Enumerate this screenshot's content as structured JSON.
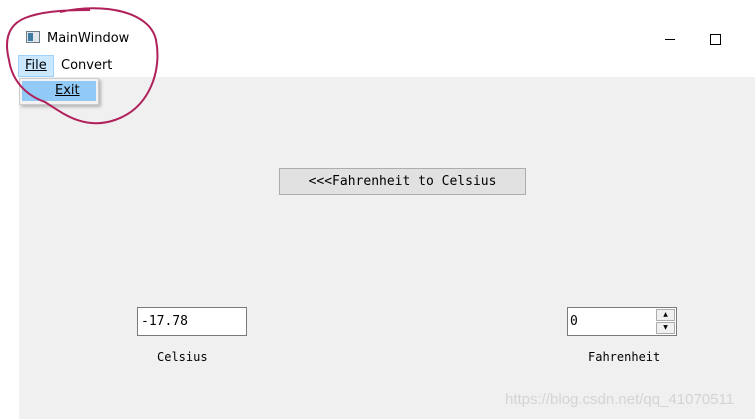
{
  "window": {
    "title": "MainWindow",
    "minimize_glyph": "minimize",
    "maximize_glyph": "maximize"
  },
  "menubar": {
    "file_label": "File",
    "convert_label": "Convert"
  },
  "file_menu": {
    "items": [
      {
        "label": "Exit"
      }
    ]
  },
  "main": {
    "convert_button_label": "<<<Fahrenheit to Celsius",
    "celsius_value": "-17.78",
    "celsius_label": "Celsius",
    "fahrenheit_value": "0",
    "fahrenheit_label": "Fahrenheit"
  },
  "watermark": "https://blog.csdn.net/qq_41070511",
  "colors": {
    "annotation": "#b0205a",
    "menu_hover": "#cce8ff",
    "menu_item_selected": "#91c9f7",
    "client_bg": "#f0f0f0"
  }
}
